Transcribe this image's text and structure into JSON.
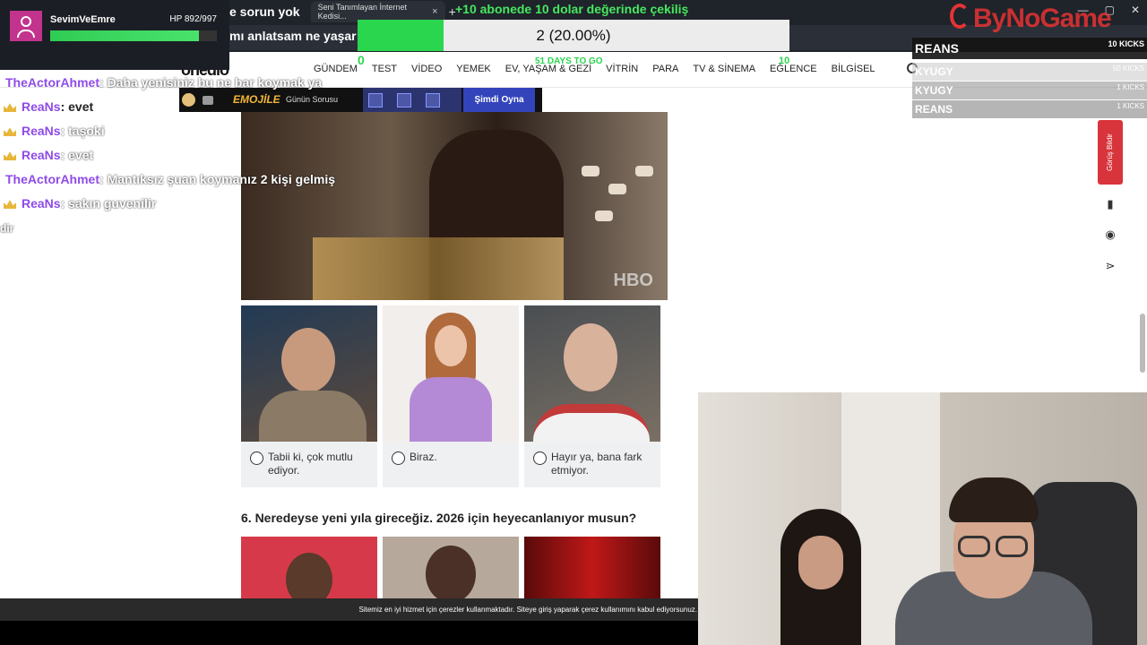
{
  "browser": {
    "page_title_fragment": "e sorun yok",
    "tab_label": "Seni Tanımlayan İnternet Kedisi...",
    "tab_close": "×",
    "new_tab": "+",
    "window_controls": [
      "—",
      "▢",
      "✕"
    ],
    "address_fragment": "mı anlatsam ne yaşar"
  },
  "site": {
    "logo": "onedio",
    "nav": [
      "GÜNDEM",
      "TEST",
      "VİDEO",
      "YEMEK",
      "EV, YAŞAM & GEZİ",
      "VİTRİN",
      "PARA",
      "TV & SİNEMA",
      "EĞLENCE",
      "BİLGİSEL"
    ],
    "subbar": {
      "emojile": "EMOJİLE",
      "gunun": "Günün Sorusu",
      "play_button": "Şimdi Oyna"
    },
    "hero_watermark": "HBO",
    "options": [
      {
        "label": "Tabii ki, çok mutlu ediyor."
      },
      {
        "label": "Biraz."
      },
      {
        "label": "Hayır ya, bana fark etmiyor."
      }
    ],
    "question": "6. Neredeyse yeni yıla gireceğiz. 2026 için heyecanlanıyor musun?",
    "cookie_notice": "Sitemiz en iyi hizmet için çerezler kullanmaktadır. Siteye giriş yaparak çerez kullanımını kabul ediyorsunuz.",
    "feedback": "Görüş Bildir",
    "side_icons": [
      "bookmark-icon",
      "comment-icon",
      "share-icon"
    ]
  },
  "overlay": {
    "player": {
      "name": "SevimVeEmre",
      "hp": "HP 892/997",
      "hp_fraction": 0.895
    },
    "giveaway": "+10 abonede 10 dolar değerinde çekiliş",
    "poll": {
      "text": "2 (20.00%)",
      "fraction": 0.2,
      "left_count": "0",
      "days": "51 DAYS TO GO",
      "right_count": "10"
    },
    "brand": "ByNoGame",
    "leaderboard": [
      {
        "name": "REANS",
        "kicks": "10 KICKS"
      },
      {
        "name": "KYUGY",
        "kicks": "50 KICKS"
      },
      {
        "name": "KYUGY",
        "kicks": "1 KICKS"
      },
      {
        "name": "REANS",
        "kicks": "1 KICKS"
      }
    ],
    "chat": [
      {
        "user": "TheActorAhmet",
        "msg": ": Daha yenisiniz bu ne bar koymak ya",
        "crown": false,
        "color": "#8f4be8"
      },
      {
        "user": "ReaNs",
        "msg": ": evet",
        "crown": true,
        "color": "#8f4be8"
      },
      {
        "user": "ReaNs",
        "msg": ": taşoki",
        "crown": true,
        "color": "#8f4be8"
      },
      {
        "user": "ReaNs",
        "msg": ": evet",
        "crown": true,
        "color": "#8f4be8"
      },
      {
        "user": "TheActorAhmet",
        "msg": ": Mantıksız şuan koymanız 2 kişi gelmiş",
        "crown": false,
        "color": "#8f4be8"
      },
      {
        "user": "ReaNs",
        "msg": ": sakın guvenilir",
        "crown": true,
        "color": "#8f4be8"
      },
      {
        "user": "",
        "msg": "dir",
        "crown": false,
        "color": "#8f4be8"
      }
    ]
  },
  "colors": {
    "accent_green": "#2bd64f",
    "brand_red": "#e63333",
    "feedback_red": "#d8343c",
    "chat_user": "#8f4be8"
  }
}
